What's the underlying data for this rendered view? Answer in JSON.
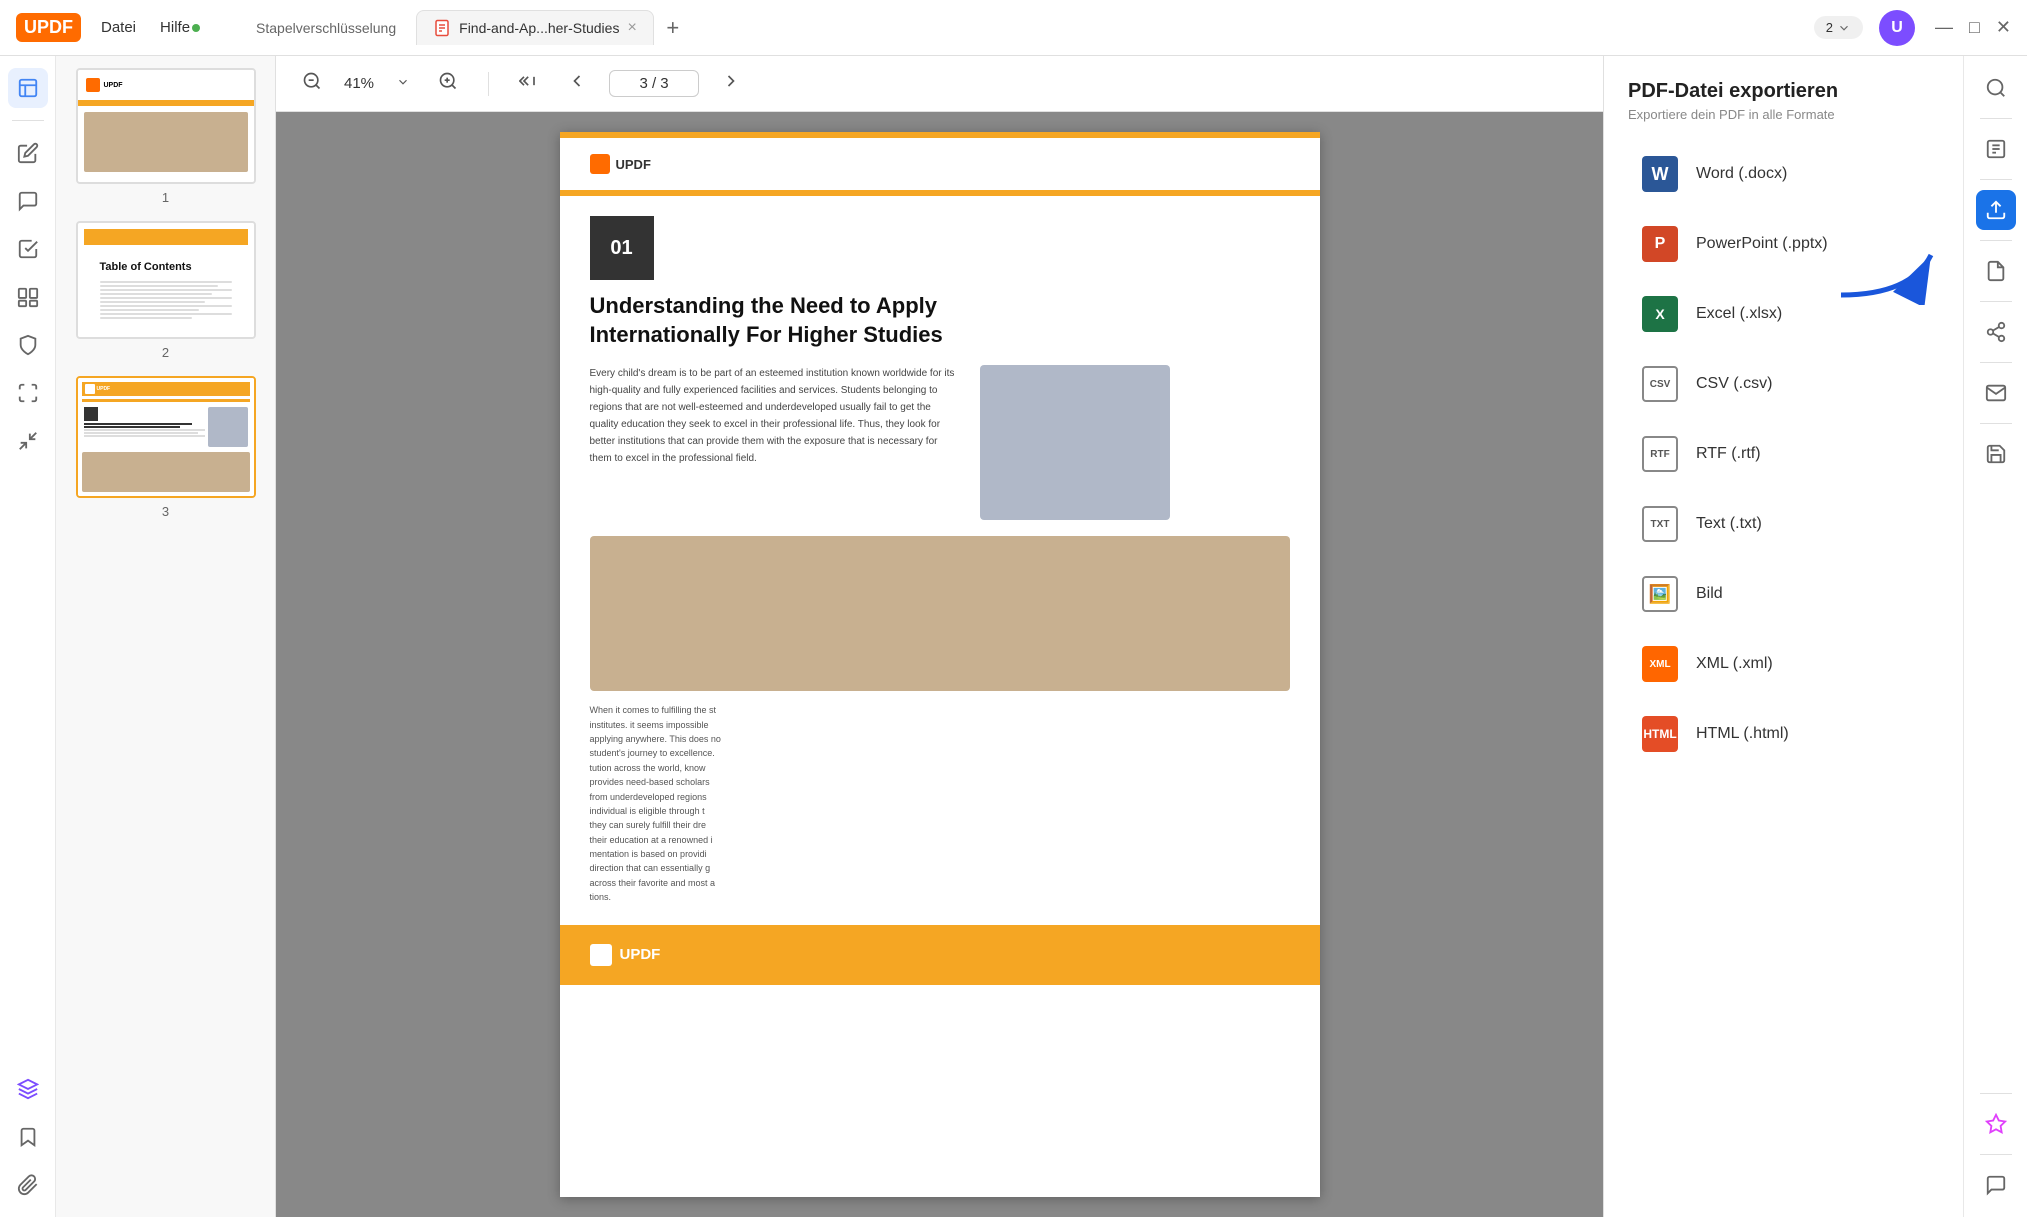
{
  "app": {
    "logo": "UPDF",
    "menu": {
      "datei": "Datei",
      "hilfe": "Hilfe"
    },
    "batch_tab": "Stapelverschlüsselung",
    "active_tab": "Find-and-Ap...her-Studies",
    "version": "2",
    "user_initial": "U"
  },
  "toolbar": {
    "zoom": "41%",
    "page_current": "3",
    "page_total": "3"
  },
  "export_panel": {
    "title": "PDF-Datei exportieren",
    "subtitle": "Exportiere dein PDF in alle Formate",
    "options": [
      {
        "id": "word",
        "label": "Word (.docx)",
        "icon": "word"
      },
      {
        "id": "ppt",
        "label": "PowerPoint (.pptx)",
        "icon": "ppt"
      },
      {
        "id": "excel",
        "label": "Excel (.xlsx)",
        "icon": "excel"
      },
      {
        "id": "csv",
        "label": "CSV (.csv)",
        "icon": "csv"
      },
      {
        "id": "rtf",
        "label": "RTF (.rtf)",
        "icon": "rtf"
      },
      {
        "id": "txt",
        "label": "Text (.txt)",
        "icon": "txt"
      },
      {
        "id": "img",
        "label": "Bild",
        "icon": "img"
      },
      {
        "id": "xml",
        "label": "XML (.xml)",
        "icon": "xml"
      },
      {
        "id": "html",
        "label": "HTML (.html)",
        "icon": "html"
      }
    ]
  },
  "thumbnails": [
    {
      "number": "1"
    },
    {
      "number": "2"
    },
    {
      "number": "3"
    }
  ],
  "pdf_page": {
    "section_number": "01",
    "title": "Understanding the Need to Apply Internationally For Higher Studies",
    "body_text": "Every child's dream is to be part of an esteemed institution known worldwide for its high-quality and fully experienced facilities and services. Students belonging to regions that are not well-esteemed and underdeveloped usually fail to get the quality education they seek to excel in their professional life. Thus, they look for better institutions that can provide them with the exposure that is necessary for them to excel in the professional field.",
    "side_text": "When it comes to fulfilling the student lives for such institutes, it seems impossible to end up applying anywhere. This does not stop the student's journey to excellence. Every institution across the world, know that this provides need-based scholarships to students from underdeveloped regions. The specific individual is eligible through the fulfilled criteria, they can surely fulfill their dream of completing their education at a renowned institution. The documentation is based on providing them with a direction that can essentially get them to work across their favorite and most appropriate institutions."
  }
}
